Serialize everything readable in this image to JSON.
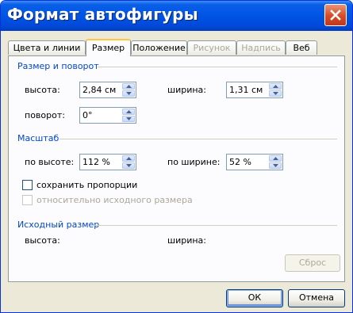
{
  "window": {
    "title": "Формат автофигуры"
  },
  "tabs": [
    {
      "label": "Цвета и линии",
      "state": "normal"
    },
    {
      "label": "Размер",
      "state": "active"
    },
    {
      "label": "Положение",
      "state": "normal"
    },
    {
      "label": "Рисунок",
      "state": "disabled"
    },
    {
      "label": "Надпись",
      "state": "disabled"
    },
    {
      "label": "Веб",
      "state": "normal"
    }
  ],
  "size_rotate": {
    "section": "Размер и поворот",
    "height_label": "высота:",
    "height_value": "2,84 см",
    "width_label": "ширина:",
    "width_value": "1,31 см",
    "rotation_label": "поворот:",
    "rotation_value": "0°"
  },
  "scale": {
    "section": "Масштаб",
    "height_label": "по высоте:",
    "height_value": "112 %",
    "width_label": "по ширине:",
    "width_value": "52 %",
    "lock_aspect_label": "сохранить пропорции",
    "lock_aspect_checked": false,
    "relative_label": "относительно исходного размера",
    "relative_checked": false
  },
  "original_size": {
    "section": "Исходный размер",
    "height_label": "высота:",
    "width_label": "ширина:",
    "reset_label": "Сброс"
  },
  "buttons": {
    "ok": "ОК",
    "cancel": "Отмена"
  }
}
